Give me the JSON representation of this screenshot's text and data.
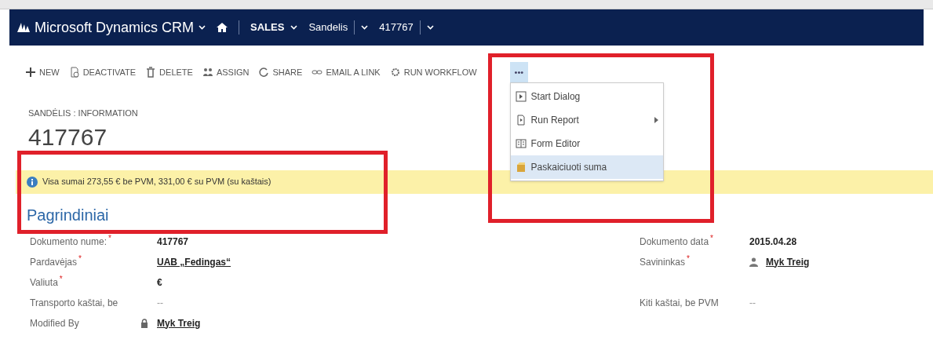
{
  "nav": {
    "brand": "Microsoft Dynamics CRM",
    "items": [
      {
        "label": "SALES",
        "kind": "menu"
      },
      {
        "label": "Sandelis",
        "kind": "split"
      },
      {
        "label": "417767",
        "kind": "split"
      }
    ]
  },
  "toolbar": [
    {
      "label": "NEW",
      "kind": "plus"
    },
    {
      "label": "DEACTIVATE",
      "kind": "deactivate"
    },
    {
      "label": "DELETE",
      "kind": "trash"
    },
    {
      "label": "ASSIGN",
      "kind": "people"
    },
    {
      "label": "SHARE",
      "kind": "share"
    },
    {
      "label": "EMAIL A LINK",
      "kind": "link"
    },
    {
      "label": "RUN WORKFLOW",
      "kind": "workflow"
    }
  ],
  "more_menu": {
    "label": "•••",
    "expanded": true,
    "items": [
      {
        "label": "Start Dialog",
        "kind": "play",
        "submenu": false,
        "selected": false
      },
      {
        "label": "Run Report",
        "kind": "report",
        "submenu": true,
        "selected": false
      },
      {
        "label": "Form Editor",
        "kind": "form",
        "submenu": false,
        "selected": false
      },
      {
        "label": "Paskaiciuoti suma",
        "kind": "box",
        "submenu": false,
        "selected": true
      }
    ]
  },
  "breadcrumb": "SANDĖLIS : INFORMATION",
  "title": "417767",
  "notification": "Visa sumai 273,55 € be PVM, 331,00 € su PVM (su kaštais)",
  "section": "Pagrindiniai",
  "rows": [
    {
      "left": {
        "label": "Dokumento nume:",
        "required": "*",
        "value": "417767",
        "kind": "text",
        "locked": false
      },
      "right": {
        "label": "Dokumento data",
        "required": "*",
        "value": "2015.04.28",
        "kind": "text",
        "user": false
      }
    },
    {
      "left": {
        "label": "Pardavėjas",
        "required": "*",
        "value": "UAB „Fedingas“",
        "kind": "link",
        "locked": false
      },
      "right": {
        "label": "Savininkas",
        "required": "*",
        "value": "Myk Treig",
        "kind": "link",
        "user": true
      }
    },
    {
      "left": {
        "label": "Valiuta",
        "required": "*",
        "value": "€",
        "kind": "text",
        "locked": false
      },
      "right": null
    },
    {
      "left": {
        "label": "Transporto kaštai, be",
        "value": "--",
        "kind": "muted",
        "locked": false
      },
      "right": {
        "label": "Kiti kaštai, be PVM",
        "value": "--",
        "kind": "muted",
        "user": false
      }
    },
    {
      "left": {
        "label": "Modified By",
        "value": "Myk Treig",
        "kind": "link",
        "locked": true
      },
      "right": null
    }
  ]
}
